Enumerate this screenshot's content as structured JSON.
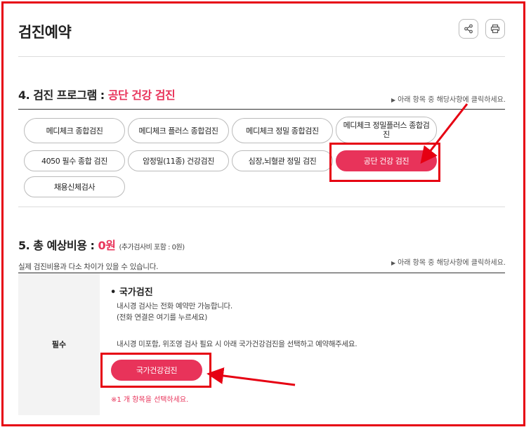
{
  "page": {
    "title": "검진예약"
  },
  "actions": {
    "share_icon": "share-icon",
    "print_icon": "print-icon"
  },
  "program": {
    "heading_prefix": "4. 검진 프로그램 : ",
    "heading_value": "공단 건강 검진",
    "hint": "아래 항목 중 해당사항에 클릭하세요.",
    "options": [
      {
        "label": "메디체크 종합검진",
        "selected": false
      },
      {
        "label": "메디체크 플러스 종합검진",
        "selected": false
      },
      {
        "label": "메디체크 정밀 종합검진",
        "selected": false
      },
      {
        "label": "메디체크 정밀플러스 종합검진",
        "selected": false
      },
      {
        "label": "4050 필수 종합 검진",
        "selected": false
      },
      {
        "label": "암정밀(11종) 건강검진",
        "selected": false
      },
      {
        "label": "심장,뇌혈관 정밀 검진",
        "selected": false
      },
      {
        "label": "공단 건강 검진",
        "selected": true
      },
      {
        "label": "채용신체검사",
        "selected": false
      }
    ]
  },
  "cost": {
    "heading_prefix": "5. 총 예상비용 : ",
    "amount": "0원",
    "extra": "(추가검사비 포함 : 0원)",
    "note": "실제 검진비용과 다소 차이가 있을 수 있습니다.",
    "hint": "아래 항목 중 해당사항에 클릭하세요."
  },
  "required": {
    "label": "필수",
    "section_title": "• 국가검진",
    "line1": "내시경 검사는 전화 예약만 가능합니다.",
    "line2": "(전화 연결은 여기를 누르세요)",
    "line3": "내시경 미포함, 위조영 검사 필요 시 아래 국가건강검진을 선택하고 예약해주세요.",
    "button": "국가건강검진",
    "warning": "※1 개 항목을 선택하세요."
  },
  "colors": {
    "accent": "#e8335a",
    "annotation": "#e60012"
  }
}
